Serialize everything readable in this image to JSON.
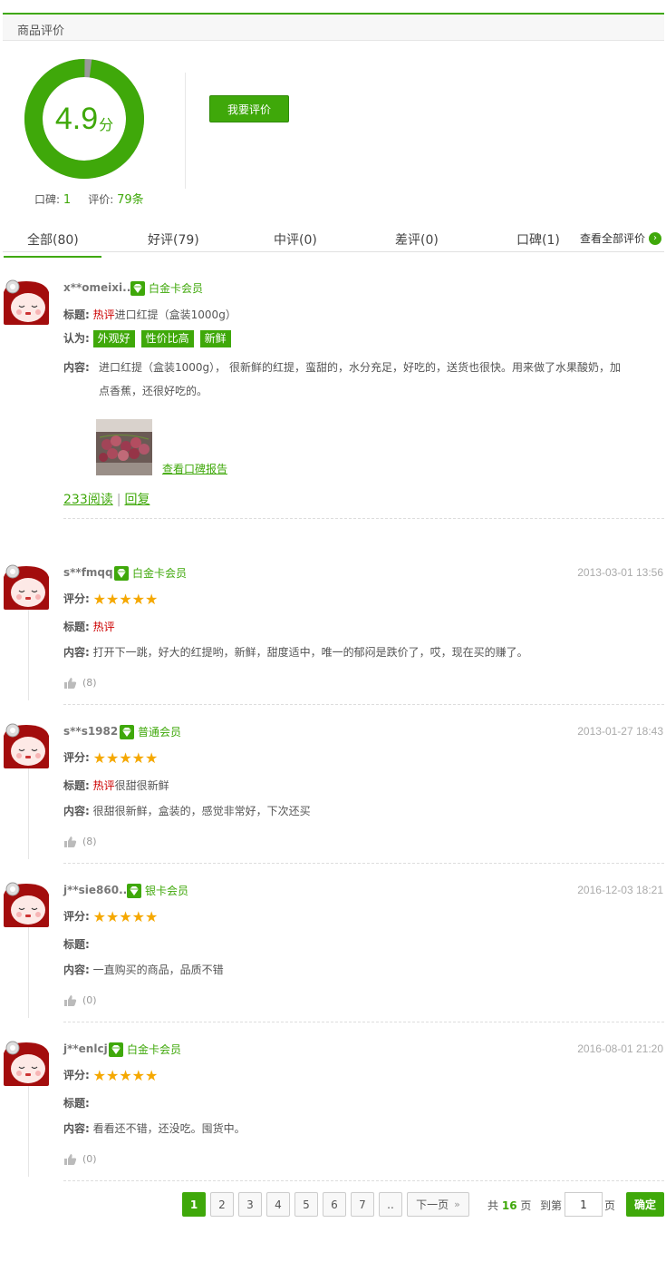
{
  "header": {
    "title": "商品评价"
  },
  "score": {
    "value": "4.9",
    "unit": "分",
    "fraction": 0.98
  },
  "stats": {
    "koubei_label": "口碑:",
    "koubei_value": "1",
    "review_label": "评价:",
    "review_value": "79条"
  },
  "actions": {
    "review_button": "我要评价"
  },
  "tabs": [
    {
      "label": "全部(80)"
    },
    {
      "label": "好评(79)"
    },
    {
      "label": "中评(0)"
    },
    {
      "label": "差评(0)"
    },
    {
      "label": "口碑(1)"
    }
  ],
  "view_all": {
    "label": "查看全部评价",
    "arrow": "›"
  },
  "labels": {
    "title": "标题:",
    "recognize": "认为:",
    "content": "内容:",
    "score": "评分:"
  },
  "featured": {
    "user": "x**omeixi...",
    "member": "白金卡会员",
    "title_hot": "热评",
    "title_text": "进口红提（盒装1000g）",
    "tags": [
      "外观好",
      "性价比高",
      "新鲜"
    ],
    "content": "进口红提（盒装1000g）， 很新鲜的红提，蛮甜的，水分充足，好吃的，送货也很快。用来做了水果酸奶，加点香蕉，还很好吃的。",
    "report_link": "查看口碑报告",
    "reads": "233阅读",
    "separator": "|",
    "reply": "回复"
  },
  "reviews": [
    {
      "user": "s**fmqq",
      "member": "白金卡会员",
      "date": "2013-03-01 13:56",
      "rating": 5,
      "title_hot": "热评",
      "title_text": "",
      "content": "打开下一跳，好大的红提哟，新鲜，甜度适中，唯一的郁闷是跌价了，哎，现在买的赚了。",
      "likes": "(8)"
    },
    {
      "user": "s**s1982",
      "member": "普通会员",
      "date": "2013-01-27 18:43",
      "rating": 5,
      "title_hot": "热评",
      "title_text": "很甜很新鲜",
      "content": "很甜很新鲜，盒装的，感觉非常好，下次还买",
      "likes": "(8)"
    },
    {
      "user": "j**sie860...",
      "member": "银卡会员",
      "date": "2016-12-03 18:21",
      "rating": 5,
      "title_hot": "",
      "title_text": "",
      "content": "一直购买的商品，品质不错",
      "likes": "(0)"
    },
    {
      "user": "j**enlcj",
      "member": "白金卡会员",
      "date": "2016-08-01 21:20",
      "rating": 5,
      "title_hot": "",
      "title_text": "",
      "content": "看看还不错，还没吃。囤货中。",
      "likes": "(0)"
    }
  ],
  "pagination": {
    "pages": [
      "1",
      "2",
      "3",
      "4",
      "5",
      "6",
      "7",
      ".."
    ],
    "current": "1",
    "next": "下一页",
    "next_arrow": "»",
    "total_prefix": "共",
    "total_pages": "16",
    "total_suffix": "页",
    "goto_prefix": "到第",
    "goto_value": "1",
    "goto_suffix": "页",
    "confirm": "确定"
  },
  "colors": {
    "accent": "#3fa80a",
    "hot": "#cc0000",
    "star": "#f5a800"
  }
}
